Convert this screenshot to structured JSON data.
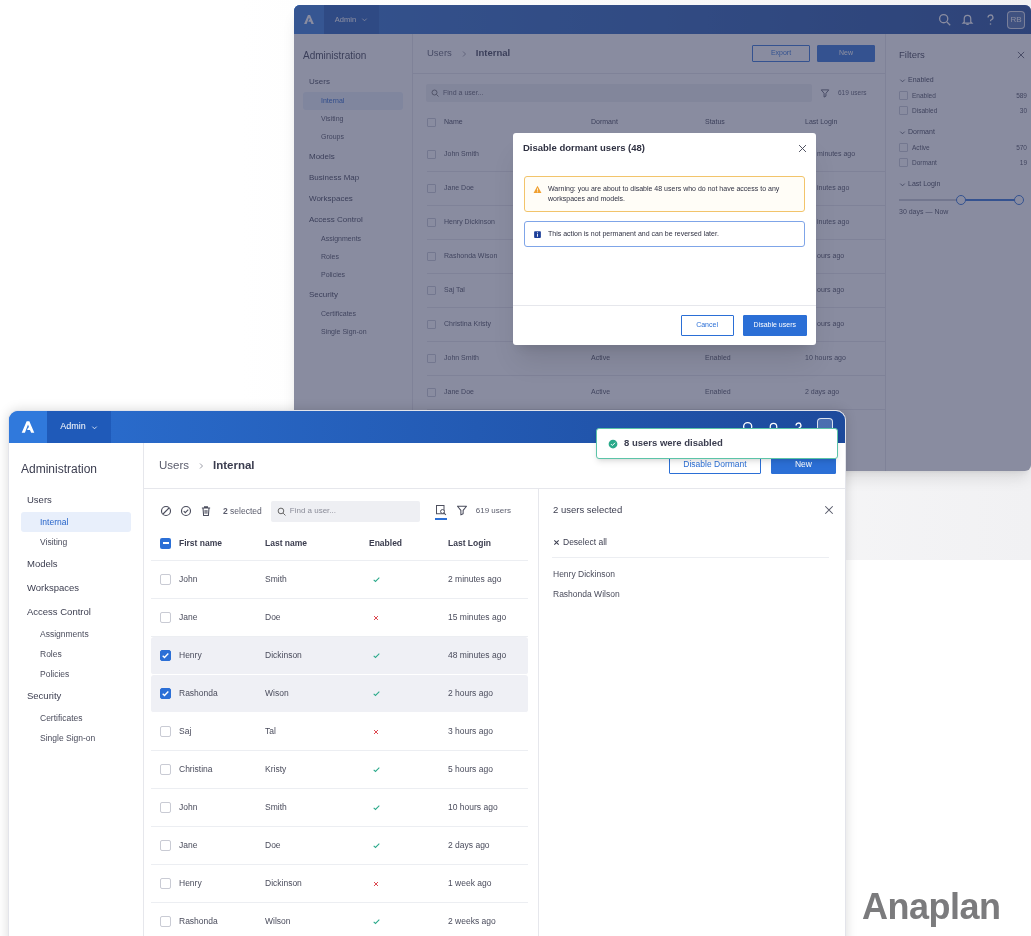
{
  "back_window": {
    "header": {
      "app_menu": "Admin",
      "avatar": "RB"
    },
    "sidebar": {
      "title": "Administration",
      "items": [
        {
          "label": "Users",
          "selected": false,
          "children": [
            {
              "label": "Internal",
              "selected": true
            },
            {
              "label": "Visiting",
              "selected": false
            },
            {
              "label": "Groups",
              "selected": false
            }
          ]
        },
        {
          "label": "Models",
          "selected": false
        },
        {
          "label": "Business Map",
          "selected": false
        },
        {
          "label": "Workspaces",
          "selected": false
        },
        {
          "label": "Access Control",
          "selected": false,
          "children": [
            {
              "label": "Assignments",
              "selected": false
            },
            {
              "label": "Roles",
              "selected": false
            },
            {
              "label": "Policies",
              "selected": false
            }
          ]
        },
        {
          "label": "Security",
          "selected": false,
          "children": [
            {
              "label": "Certificates",
              "selected": false
            },
            {
              "label": "Single Sign-on",
              "selected": false
            }
          ]
        }
      ]
    },
    "breadcrumb": [
      "Users",
      "Internal"
    ],
    "buttons": [
      {
        "label": "Export",
        "kind": "secondary"
      },
      {
        "label": "New",
        "kind": "primary"
      }
    ],
    "search": {
      "placeholder": "Find a user..."
    },
    "count": "619 users",
    "table": {
      "columns": [
        "Name",
        "Dormant",
        "Status",
        "Last Login"
      ],
      "header_checked": false,
      "rows": [
        {
          "checked": false,
          "name": "John Smith",
          "last_login": "minutes ago"
        },
        {
          "checked": false,
          "name": "Jane Doe",
          "last_login": "inutes ago"
        },
        {
          "checked": false,
          "name": "Henry Dickinson",
          "last_login": "inutes ago"
        },
        {
          "checked": false,
          "name": "Rashonda Wison",
          "last_login": "ours ago"
        },
        {
          "checked": false,
          "name": "Saj Tal",
          "last_login": "ours ago"
        },
        {
          "checked": false,
          "name": "Christina Kristy",
          "last_login": "ours ago"
        },
        {
          "checked": false,
          "name": "John Smith",
          "dormant": "Active",
          "status": "Enabled",
          "last_login": "10 hours ago"
        },
        {
          "checked": false,
          "name": "Jane Doe",
          "dormant": "Active",
          "status": "Enabled",
          "last_login": "2 days ago"
        }
      ]
    },
    "filters": {
      "title": "Filters",
      "sections": [
        {
          "kind": "options",
          "title": "Enabled",
          "expanded": true,
          "options": [
            {
              "label": "Enabled",
              "count": "589",
              "checked": false
            },
            {
              "label": "Disabled",
              "count": "30",
              "checked": false
            }
          ]
        },
        {
          "kind": "options",
          "title": "Dormant",
          "expanded": true,
          "options": [
            {
              "label": "Active",
              "count": "570",
              "checked": false
            },
            {
              "label": "Dormant",
              "count": "19",
              "checked": false
            }
          ]
        },
        {
          "kind": "range",
          "title": "Last Login",
          "expanded": true,
          "level": 0.5,
          "reading": "30 days — Now"
        }
      ]
    }
  },
  "dialog": {
    "title": "Disable dormant users (48)",
    "alerts": [
      {
        "kind": "warning",
        "text": "Warning: you are about to disable 48 users who do not have access to any workspaces and models."
      },
      {
        "kind": "info",
        "text": "This action is not permanent and can be reversed later."
      }
    ],
    "buttons": [
      {
        "label": "Cancel",
        "kind": "secondary"
      },
      {
        "label": "Disable users",
        "kind": "primary"
      }
    ]
  },
  "front_window": {
    "header": {
      "app_menu": "Admin"
    },
    "sidebar": {
      "title": "Administration",
      "items": [
        {
          "label": "Users",
          "selected": false,
          "children": [
            {
              "label": "Internal",
              "selected": true
            },
            {
              "label": "Visiting",
              "selected": false
            }
          ]
        },
        {
          "label": "Models",
          "selected": false
        },
        {
          "label": "Workspaces",
          "selected": false
        },
        {
          "label": "Access Control",
          "selected": false,
          "children": [
            {
              "label": "Assignments",
              "selected": false
            },
            {
              "label": "Roles",
              "selected": false
            },
            {
              "label": "Policies",
              "selected": false
            }
          ]
        },
        {
          "label": "Security",
          "selected": false,
          "children": [
            {
              "label": "Certificates",
              "selected": false
            },
            {
              "label": "Single Sign-on",
              "selected": false
            }
          ]
        }
      ]
    },
    "breadcrumb": [
      "Users",
      "Internal"
    ],
    "buttons": [
      {
        "label": "Disable Dormant",
        "kind": "secondary"
      },
      {
        "label": "New",
        "kind": "primary"
      }
    ],
    "selection": "**2** selected",
    "search": {
      "placeholder": "Find a user..."
    },
    "view_tools": [
      {
        "kind": "inspect",
        "selected": true
      },
      {
        "kind": "filter",
        "selected": false
      }
    ],
    "count": "619 users",
    "table": {
      "columns": [
        "First name",
        "Last name",
        "Enabled",
        "Last Login"
      ],
      "header_indeterminate": true,
      "rows": [
        {
          "checked": false,
          "first": "John",
          "last": "Smith",
          "enabled": true,
          "last_login": "2 minutes ago"
        },
        {
          "checked": false,
          "first": "Jane",
          "last": "Doe",
          "enabled": false,
          "last_login": "15 minutes ago"
        },
        {
          "checked": true,
          "first": "Henry",
          "last": "Dickinson",
          "enabled": true,
          "last_login": "48 minutes ago"
        },
        {
          "checked": true,
          "first": "Rashonda",
          "last": "Wison",
          "enabled": true,
          "last_login": "2 hours ago"
        },
        {
          "checked": false,
          "first": "Saj",
          "last": "Tal",
          "enabled": false,
          "last_login": "3 hours ago"
        },
        {
          "checked": false,
          "first": "Christina",
          "last": "Kristy",
          "enabled": true,
          "last_login": "5 hours ago"
        },
        {
          "checked": false,
          "first": "John",
          "last": "Smith",
          "enabled": true,
          "last_login": "10 hours ago"
        },
        {
          "checked": false,
          "first": "Jane",
          "last": "Doe",
          "enabled": true,
          "last_login": "2 days ago"
        },
        {
          "checked": false,
          "first": "Henry",
          "last": "Dickinson",
          "enabled": false,
          "last_login": "1 week ago"
        },
        {
          "checked": false,
          "first": "Rashonda",
          "last": "Wilson",
          "enabled": true,
          "last_login": "2 weeks ago"
        }
      ]
    },
    "selection_panel": {
      "title": "2 users selected",
      "deselect": "Deselect all",
      "names": [
        "Henry Dickinson",
        "Rashonda Wilson"
      ]
    }
  },
  "toast": {
    "message": "8 users were disabled"
  },
  "brand": "Anaplan"
}
